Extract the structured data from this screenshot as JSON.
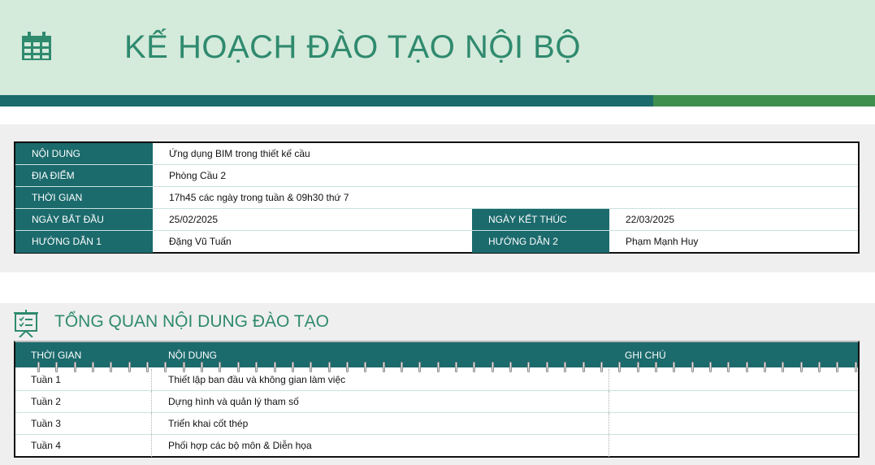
{
  "header": {
    "title": "KẾ HOẠCH ĐÀO TẠO NỘI BỘ",
    "icon": "calendar-icon"
  },
  "colors": {
    "header_bg": "#d4eadb",
    "teal": "#1b6a6c",
    "green": "#3f8f4f",
    "title": "#2f8a6e"
  },
  "info": {
    "content_label": "NỘI DUNG",
    "content_value": "Ứng dụng BIM trong thiết kế cầu",
    "location_label": "ĐỊA ĐIỂM",
    "location_value": "Phòng Cầu 2",
    "time_label": "THỜI GIAN",
    "time_value": "17h45 các ngày trong tuần & 09h30 thứ 7",
    "start_label": "NGÀY BẮT ĐẦU",
    "start_value": "25/02/2025",
    "end_label": "NGÀY KẾT THÚC",
    "end_value": "22/03/2025",
    "instructor1_label": "HƯỚNG DẪN 1",
    "instructor1_value": "Đặng Vũ Tuấn",
    "instructor2_label": "HƯỚNG DẪN 2",
    "instructor2_value": "Phạm Mạnh Huy"
  },
  "overview": {
    "title": "TỔNG QUAN NỘI DUNG ĐÀO TẠO",
    "icon": "presentation-board-icon",
    "headers": {
      "time": "THỜI GIAN",
      "content": "NỘI DUNG",
      "note": "GHI CHÚ"
    },
    "rows": [
      {
        "time": "Tuần 1",
        "content": "Thiết lập ban đầu và không gian làm việc",
        "note": ""
      },
      {
        "time": "Tuần 2",
        "content": "Dựng hình và quản lý tham số",
        "note": ""
      },
      {
        "time": "Tuần 3",
        "content": "Triển khai cốt thép",
        "note": ""
      },
      {
        "time": "Tuần 4",
        "content": "Phối hợp các bộ môn & Diễn họa",
        "note": ""
      }
    ]
  }
}
